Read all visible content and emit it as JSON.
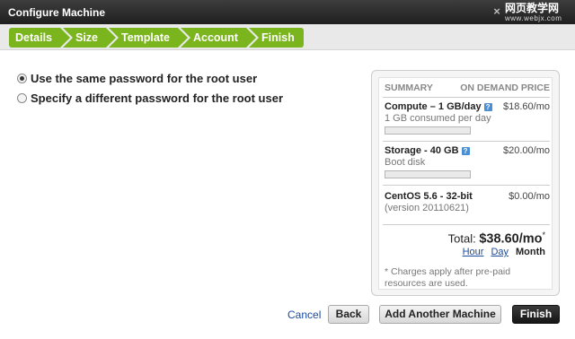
{
  "window": {
    "title": "Configure Machine",
    "close_glyph": "×",
    "watermark": "网页教学网",
    "watermark_url": "www.webjx.com"
  },
  "steps": [
    "Details",
    "Size",
    "Template",
    "Account",
    "Finish"
  ],
  "options": [
    {
      "label": "Use the same password for the root user",
      "checked": true
    },
    {
      "label": "Specify a different password for the root user",
      "checked": false
    }
  ],
  "summary": {
    "header_left": "SUMMARY",
    "header_right": "ON DEMAND PRICE",
    "items": [
      {
        "name": "Compute – 1 GB/day",
        "price": "$18.60/mo",
        "sub": "1 GB consumed per day",
        "has_help": true,
        "has_bar": true
      },
      {
        "name": "Storage - 40 GB",
        "price": "$20.00/mo",
        "sub": "Boot disk",
        "has_help": true,
        "has_bar": true
      },
      {
        "name": "CentOS 5.6 - 32-bit",
        "price": "$0.00/mo",
        "sub": "(version 20110621)",
        "has_help": false,
        "has_bar": false
      }
    ],
    "total_label": "Total:",
    "total_value": "$38.60/mo",
    "total_mark": "*",
    "periods": {
      "hour": "Hour",
      "day": "Day",
      "month": "Month"
    },
    "note": "* Charges apply after pre-paid resources are used."
  },
  "footer": {
    "cancel": "Cancel",
    "back": "Back",
    "add_another": "Add Another Machine",
    "finish": "Finish"
  }
}
